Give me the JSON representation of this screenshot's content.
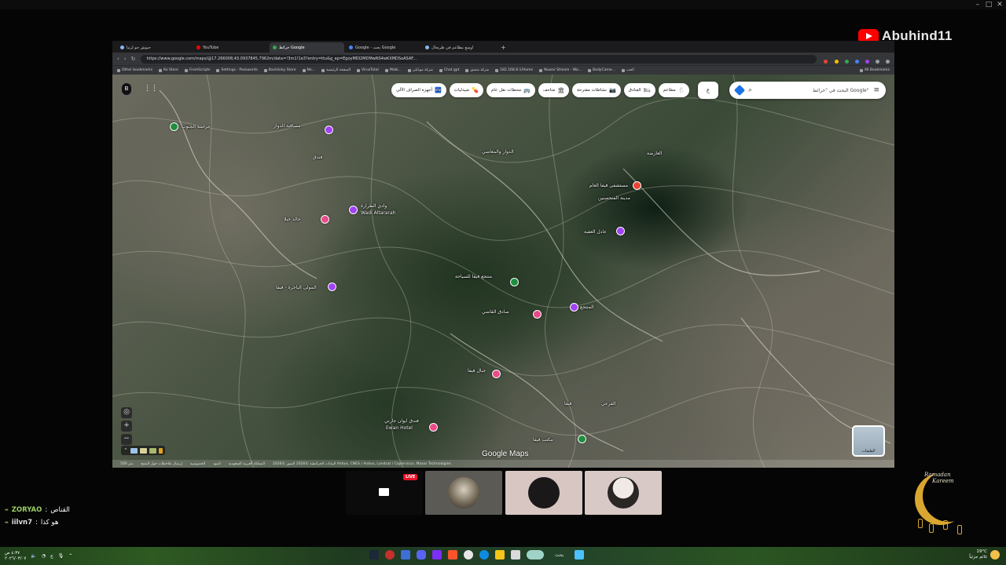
{
  "channel": {
    "name": "Abuhind11"
  },
  "outer_window": {
    "minimize": "–",
    "maximize": "□",
    "close": "✕"
  },
  "browser": {
    "tabs": [
      {
        "label": "حيوش جو لرتيا"
      },
      {
        "label": "YouTube"
      },
      {
        "label": "خرائط Google"
      },
      {
        "label": "Google - بحث Google"
      },
      {
        "label": "اوسع مطاعم في طريحال"
      }
    ],
    "new_tab": "+",
    "url": "https://www.google.com/maps/@17.266008,43.0937845,7962m/data=!3m1!1e3?entry=ttu&g_ep=EgoyMDI2MDMwNS4wKXMDSoASAF...",
    "bookmarks": [
      "Other bookmarks",
      "Ko Store",
      "FromScripts",
      "Settings - Passwords",
      "Backlinky Store",
      "Ne...",
      "الصفحة الرئيسية",
      "VirusTotal",
      "Mobi...",
      "شركة موبايلي",
      "Chat gpt",
      "شركة منشق",
      "182.168.8.1/Home",
      "Nuwar Stream - Wa...",
      "BodyCame...",
      "الحب"
    ],
    "bookmarks_right": "All Bookmarks"
  },
  "map": {
    "search_placeholder": "البحث في \"خرائط Google\"",
    "lang_button": "ع",
    "chips": [
      {
        "label": "مطاعم",
        "icon": "🍴"
      },
      {
        "label": "الفنادق",
        "icon": "🛏"
      },
      {
        "label": "نشاطات مقترحة",
        "icon": "📷"
      },
      {
        "label": "متاحف",
        "icon": "🏛"
      },
      {
        "label": "محطات نقل عام",
        "icon": "🚌"
      },
      {
        "label": "صيدليات",
        "icon": "💊"
      },
      {
        "label": "أجهزة الصراف الآلي",
        "icon": "🏧"
      }
    ],
    "labels": [
      "حراسة الجنوب",
      "فندق",
      "مساقية الدوار",
      "الدوار والمعاصي",
      "العارضة",
      "مدينة المتحصنين",
      "مستشفى فيفا العام",
      "عادل العقبة",
      "وادي الطرارة",
      "Wadi Altararah",
      "خالد حيلا",
      "المولى الباخرة - فيفا",
      "منتجع فيفا للسياحة",
      "صادق القاضي",
      "المنتجع",
      "فيفا",
      "جبال فيفا",
      "فندق ايوان جارتي",
      "Ewan Hotel",
      "مكتب فيفا",
      "الفرعي"
    ],
    "logo": "Google Maps",
    "layers_label": "الطبقات",
    "attribution": [
      "البيانات الخرائطية ©2026 الصور ©2026 Airbus, CNES / Airbus, Landsat / Copernicus, Maxar Technologies",
      "المملكة العربية السعودية",
      "البنود",
      "الخصوصية",
      "إرسال ملاحظات حول المنتج",
      "500 متر"
    ]
  },
  "stream": {
    "live_badge": "LIVE",
    "chat": [
      {
        "user": "ZORYAO",
        "message": "القناص"
      },
      {
        "user": "iilvn7",
        "message": "هو كذا"
      }
    ]
  },
  "ramadan": {
    "title": "Ramadan",
    "subtitle": "Kareem"
  },
  "taskbar": {
    "time": "٤:٣٧ ص",
    "date": "٢٠٢٦/٠٣/٠٧",
    "search": "بحث",
    "temperature": "19°C",
    "weather_text": "غائم جزئياً"
  }
}
